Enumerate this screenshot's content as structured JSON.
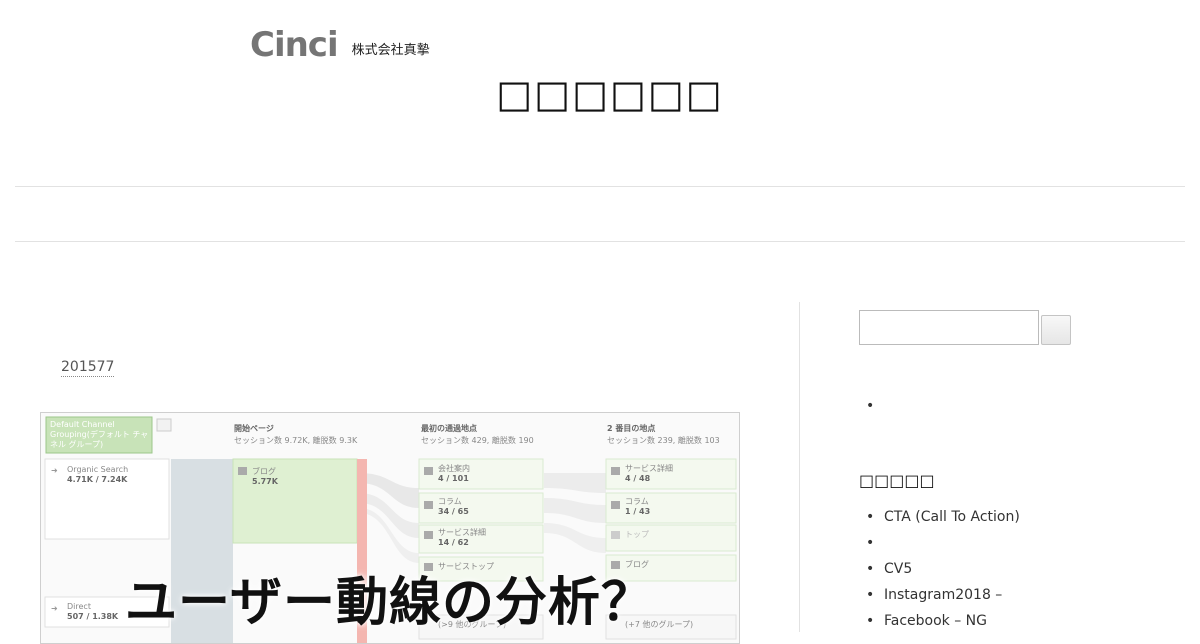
{
  "header": {
    "logo_text": "Cinci",
    "company_name": "株式会社真摯",
    "site_title": "□□□□□□"
  },
  "post": {
    "date": "201577",
    "headline": "ユーザー動線の分析？",
    "thumbnail": {
      "channel_label_1": "Default Channel",
      "channel_label_2": "Grouping(デフォルト チャ",
      "channel_label_3": "ネル グループ)",
      "col1_title": "開始ページ",
      "col1_sub": "セッション数 9.72K, 離脱数 9.3K",
      "col2_title": "最初の通過地点",
      "col2_sub": "セッション数 429, 離脱数 190",
      "col3_title": "2 番目の地点",
      "col3_sub": "セッション数 239, 離脱数 103",
      "source1_name": "Organic Search",
      "source1_val": "4.71K / 7.24K",
      "source2_name": "Direct",
      "source2_val": "507 / 1.38K",
      "start_name": "ブログ",
      "start_val": "5.77K",
      "mid_nodes": [
        {
          "name": "会社案内",
          "val": "4 / 101"
        },
        {
          "name": "コラム",
          "val": "34 / 65"
        },
        {
          "name": "サービス詳細",
          "val": "14 / 62"
        },
        {
          "name": "サービストップ",
          "val": ""
        },
        {
          "name": "(>9 他のグループ)",
          "val": ""
        }
      ],
      "end_nodes": [
        {
          "name": "サービス詳細",
          "val": "4 / 48"
        },
        {
          "name": "コラム",
          "val": "1 / 43"
        },
        {
          "name": "トップ",
          "val": ""
        },
        {
          "name": "ブログ",
          "val": ""
        },
        {
          "name": "(+7 他のグループ)",
          "val": ""
        }
      ]
    }
  },
  "sidebar": {
    "search_placeholder": "",
    "empty_bullet": "",
    "widget_title": "□□□□□",
    "items": [
      "CTA (Call To Action)",
      "",
      "CV5",
      "Instagram2018 –",
      "Facebook – NG"
    ]
  }
}
